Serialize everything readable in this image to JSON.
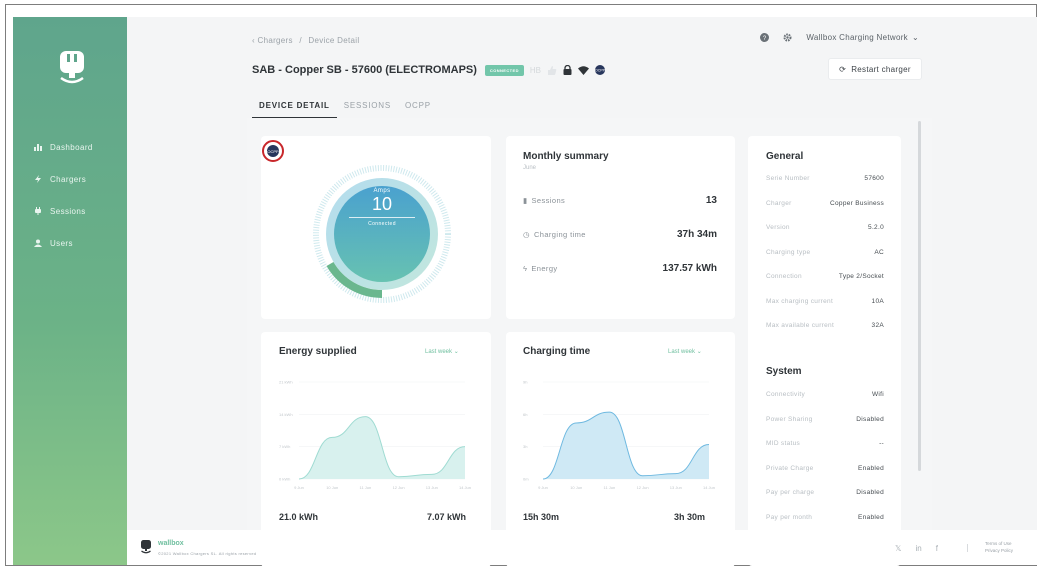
{
  "sidebar": {
    "items": [
      {
        "label": "Dashboard",
        "icon": "bar-chart-icon"
      },
      {
        "label": "Chargers",
        "icon": "bolt-icon"
      },
      {
        "label": "Sessions",
        "icon": "plug-icon"
      },
      {
        "label": "Users",
        "icon": "user-icon"
      }
    ]
  },
  "breadcrumb": {
    "parent": "Chargers",
    "sep": "/",
    "current": "Device Detail"
  },
  "header": {
    "title": "SAB - Copper SB - 57600 (ELECTROMAPS)",
    "status_badge": "CONNECTED",
    "dim_label": "HB",
    "network": "Wallbox Charging Network",
    "restart_label": "Restart charger"
  },
  "tabs": [
    {
      "label": "DEVICE DETAIL",
      "active": true
    },
    {
      "label": "SESSIONS",
      "active": false
    },
    {
      "label": "OCPP",
      "active": false
    }
  ],
  "ocpp_badge": "OCPP",
  "gauge": {
    "label": "Amps",
    "value": "10",
    "status": "Connected"
  },
  "monthly": {
    "title": "Monthly summary",
    "subtitle": "June",
    "rows": [
      {
        "label": "Sessions",
        "value": "13",
        "icon": "plug-icon"
      },
      {
        "label": "Charging time",
        "value": "37h 34m",
        "icon": "clock-icon"
      },
      {
        "label": "Energy",
        "value": "137.57 kWh",
        "icon": "bolt-icon"
      }
    ]
  },
  "general": {
    "title": "General",
    "rows": [
      {
        "k": "Serie Number",
        "v": "57600"
      },
      {
        "k": "Charger",
        "v": "Copper Business"
      },
      {
        "k": "Version",
        "v": "5.2.0"
      },
      {
        "k": "Charging type",
        "v": "AC"
      },
      {
        "k": "Connection",
        "v": "Type 2/Socket"
      },
      {
        "k": "Max charging current",
        "v": "10A"
      },
      {
        "k": "Max available current",
        "v": "32A"
      }
    ]
  },
  "system": {
    "title": "System",
    "rows": [
      {
        "k": "Connectivity",
        "v": "Wifi"
      },
      {
        "k": "Power Sharing",
        "v": "Disabled"
      },
      {
        "k": "MID status",
        "v": "--"
      },
      {
        "k": "Private Charge",
        "v": "Enabled"
      },
      {
        "k": "Pay per charge",
        "v": "Disabled"
      },
      {
        "k": "Pay per month",
        "v": "Enabled"
      }
    ]
  },
  "energy_card": {
    "title": "Energy supplied",
    "range": "Last week",
    "total_left": "21.0 kWh",
    "total_right": "7.07 kWh"
  },
  "charge_card": {
    "title": "Charging time",
    "range": "Last week",
    "total_left": "15h 30m",
    "total_right": "3h 30m"
  },
  "chart_data": [
    {
      "type": "area",
      "title": "Energy supplied",
      "x": [
        "9 Jun",
        "10 Jun",
        "11 Jun",
        "12 Jun",
        "13 Jun",
        "14 Jun"
      ],
      "y_ticks": [
        "0 kWh",
        "7 kWh",
        "14 kWh",
        "21 kWh"
      ],
      "ylim": [
        0,
        21
      ],
      "values": [
        0,
        9,
        13.5,
        0.5,
        1,
        7
      ]
    },
    {
      "type": "area",
      "title": "Charging time",
      "x": [
        "9 Jun",
        "10 Jun",
        "11 Jun",
        "12 Jun",
        "13 Jun",
        "14 Jun"
      ],
      "y_ticks": [
        "0m",
        "3h",
        "6h",
        "9h"
      ],
      "ylim": [
        0,
        9
      ],
      "values": [
        0,
        5.2,
        6.2,
        0.3,
        0.5,
        3.2
      ]
    }
  ],
  "footer": {
    "brand": "wallbox",
    "copyright": "©2021 Wallbox Chargers SL. All rights reserved",
    "social": [
      "𝕏",
      "in",
      "f"
    ],
    "links": [
      "Terms of Use",
      "Privacy Policy"
    ]
  },
  "colors": {
    "sidebar_top": "#5fa58c",
    "sidebar_bottom": "#8cc789",
    "accent": "#6fbf9f",
    "chart_fill_energy": "#d8f1ee",
    "chart_fill_charge": "#cfe9f5"
  }
}
